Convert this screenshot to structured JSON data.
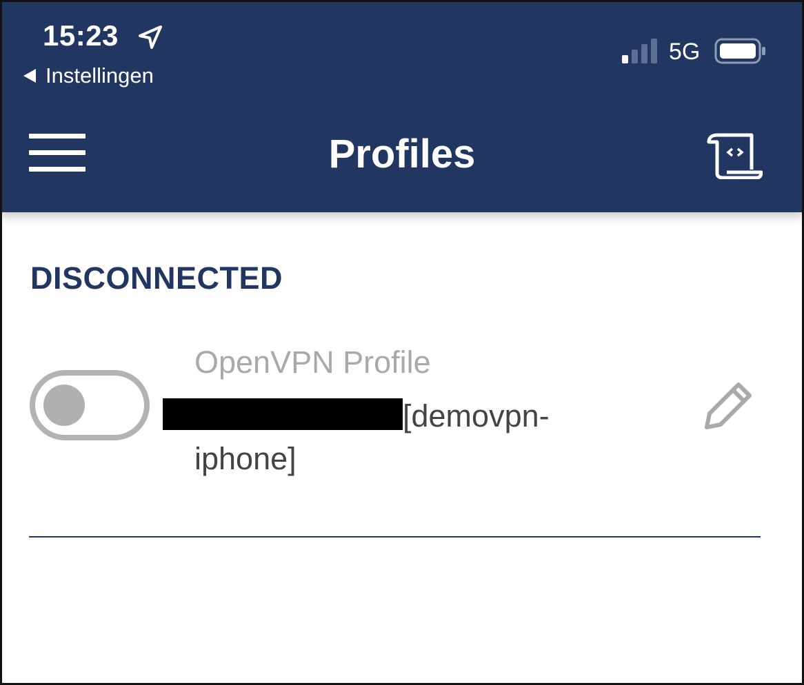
{
  "status_bar": {
    "time": "15:23",
    "back_label": "Instellingen",
    "network": "5G",
    "signal_bars_active": 1,
    "signal_bars_total": 4
  },
  "nav": {
    "title": "Profiles",
    "menu_icon": "hamburger-menu-icon",
    "import_icon": "import-file-icon"
  },
  "connection": {
    "status": "DISCONNECTED"
  },
  "profile": {
    "type": "OpenVPN Profile",
    "name": "[demovpn-iphone]",
    "toggle_on": false,
    "edit_icon": "pencil-icon"
  },
  "colors": {
    "header_bg": "#213661",
    "accent": "#213661",
    "toggle_off": "#b3b3b3"
  }
}
